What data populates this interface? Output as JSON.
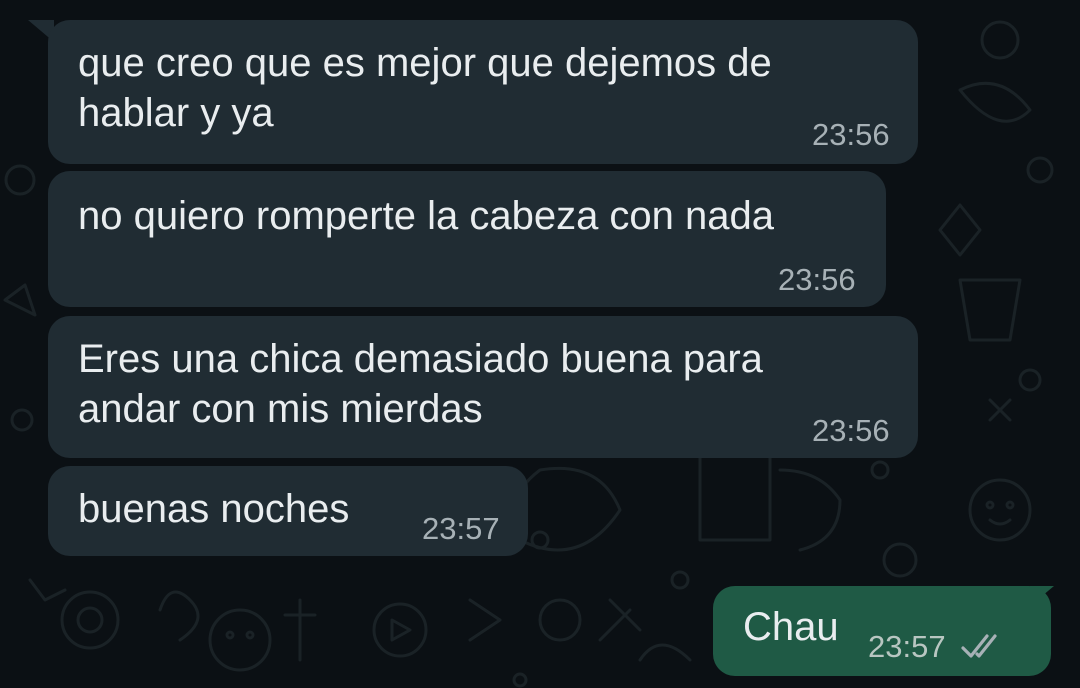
{
  "chat": {
    "messages": [
      {
        "direction": "incoming",
        "lines": [
          "que creo que es mejor que dejemos de",
          "hablar y ya"
        ],
        "time": "23:56"
      },
      {
        "direction": "incoming",
        "lines": [
          "no quiero romperte la cabeza con nada"
        ],
        "time": "23:56"
      },
      {
        "direction": "incoming",
        "lines": [
          "Eres una chica demasiado buena para",
          "andar con mis mierdas"
        ],
        "time": "23:56"
      },
      {
        "direction": "incoming",
        "lines": [
          "buenas noches"
        ],
        "time": "23:57"
      },
      {
        "direction": "outgoing",
        "lines": [
          "Chau"
        ],
        "time": "23:57",
        "status_icon": "double-check-icon",
        "status": "read"
      }
    ]
  },
  "colors": {
    "background": "#0b1014",
    "incoming_bubble": "#202c33",
    "outgoing_bubble": "#1f5a45",
    "message_text": "#e9edef",
    "timestamp_text": "#a7b1b6",
    "read_ticks": "#a7b1b6"
  }
}
